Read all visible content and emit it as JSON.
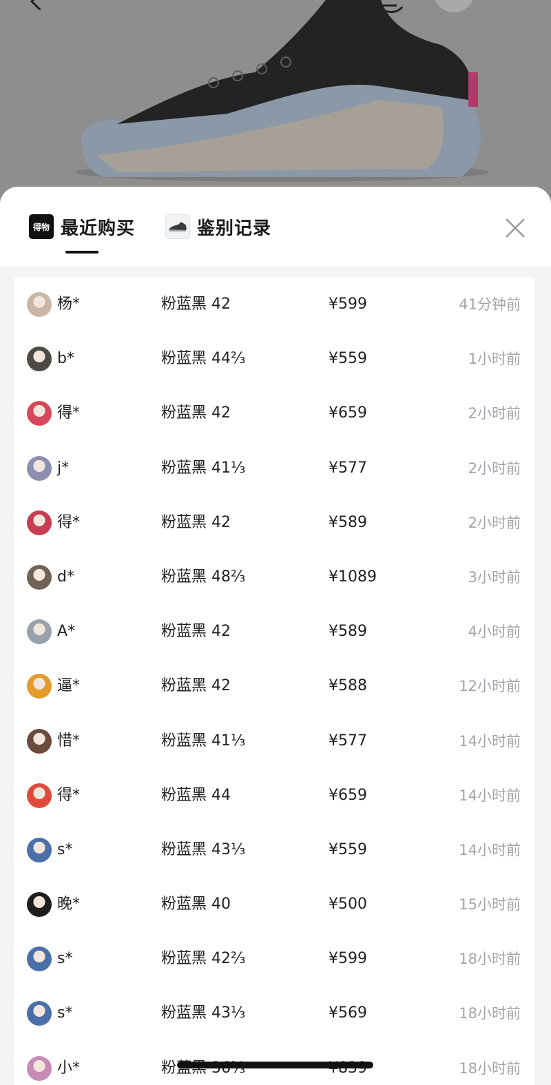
{
  "tabs": [
    {
      "label": "最近购买",
      "icon": "brand-logo-icon",
      "icon_text": "得物"
    },
    {
      "label": "鉴别记录",
      "icon": "shoe-thumbnail-icon"
    }
  ],
  "records": [
    {
      "name": "杨*",
      "spec": "粉蓝黑 42",
      "price": "¥599",
      "time": "41分钟前",
      "avatar_color": "#c9b6a6"
    },
    {
      "name": "b*",
      "spec": "粉蓝黑 44⅔",
      "price": "¥559",
      "time": "1小时前",
      "avatar_color": "#4d4a46"
    },
    {
      "name": "得*",
      "spec": "粉蓝黑 42",
      "price": "¥659",
      "time": "2小时前",
      "avatar_color": "#d7475a"
    },
    {
      "name": "j*",
      "spec": "粉蓝黑 41⅓",
      "price": "¥577",
      "time": "2小时前",
      "avatar_color": "#8d8fb0"
    },
    {
      "name": "得*",
      "spec": "粉蓝黑 42",
      "price": "¥589",
      "time": "2小时前",
      "avatar_color": "#c73e52"
    },
    {
      "name": "d*",
      "spec": "粉蓝黑 48⅔",
      "price": "¥1089",
      "time": "3小时前",
      "avatar_color": "#6f6454"
    },
    {
      "name": "A*",
      "spec": "粉蓝黑 42",
      "price": "¥589",
      "time": "4小时前",
      "avatar_color": "#9aa1ad"
    },
    {
      "name": "逼*",
      "spec": "粉蓝黑 42",
      "price": "¥588",
      "time": "12小时前",
      "avatar_color": "#e39b2e"
    },
    {
      "name": "惜*",
      "spec": "粉蓝黑 41⅓",
      "price": "¥577",
      "time": "14小时前",
      "avatar_color": "#6b4b3b"
    },
    {
      "name": "得*",
      "spec": "粉蓝黑 44",
      "price": "¥659",
      "time": "14小时前",
      "avatar_color": "#e14a3b"
    },
    {
      "name": "s*",
      "spec": "粉蓝黑 43⅓",
      "price": "¥559",
      "time": "14小时前",
      "avatar_color": "#4b6fa8"
    },
    {
      "name": "晚*",
      "spec": "粉蓝黑 40",
      "price": "¥500",
      "time": "15小时前",
      "avatar_color": "#1e1e1e"
    },
    {
      "name": "s*",
      "spec": "粉蓝黑 42⅔",
      "price": "¥599",
      "time": "18小时前",
      "avatar_color": "#4b6fa8"
    },
    {
      "name": "s*",
      "spec": "粉蓝黑 43⅓",
      "price": "¥569",
      "time": "18小时前",
      "avatar_color": "#4b6fa8"
    },
    {
      "name": "小*",
      "spec": "粉蓝黑 36⅔",
      "price": "¥839",
      "time": "18小时前",
      "avatar_color": "#c88ab7"
    }
  ],
  "icons": {
    "back": "back-arrow-icon",
    "share": "share-icon",
    "wechat": "wechat-icon",
    "close": "close-icon"
  }
}
